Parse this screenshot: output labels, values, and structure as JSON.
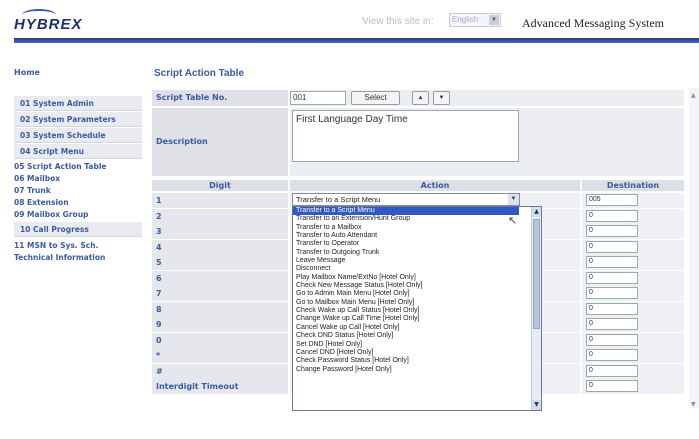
{
  "header": {
    "logo": "HYBREX",
    "view_label": "View this site in:",
    "language": "English",
    "app_title": "Advanced Messaging System"
  },
  "sidebar": {
    "home": "Home",
    "items": [
      {
        "label": "01 System Admin",
        "boxed": true
      },
      {
        "label": "02 System Parameters",
        "boxed": true
      },
      {
        "label": "03 System Schedule",
        "boxed": true
      },
      {
        "label": "04 Script Menu",
        "boxed": true
      },
      {
        "label": "05 Script Action Table",
        "boxed": false
      },
      {
        "label": "06 Mailbox",
        "boxed": false
      },
      {
        "label": "07 Trunk",
        "boxed": false
      },
      {
        "label": "08 Extension",
        "boxed": false
      },
      {
        "label": "09 Mailbox Group",
        "boxed": false
      },
      {
        "label": "10 Call Progress",
        "boxed": true
      },
      {
        "label": "11 MSN to Sys. Sch.",
        "boxed": false
      },
      {
        "label": "Technical Information",
        "boxed": false
      }
    ]
  },
  "main": {
    "title": "Script Action Table",
    "script_table_label": "Script Table No.",
    "script_table_value": "001",
    "select_button": "Select",
    "up_button": "▲",
    "down_button": "▼",
    "description_label": "Description",
    "description_value": "First Language Day Time",
    "columns": {
      "digit": "Digit",
      "action": "Action",
      "destination": "Destination"
    },
    "rows": [
      {
        "digit": "1",
        "dest": "005"
      },
      {
        "digit": "2",
        "dest": "0"
      },
      {
        "digit": "3",
        "dest": "0"
      },
      {
        "digit": "4",
        "dest": "0"
      },
      {
        "digit": "5",
        "dest": "0"
      },
      {
        "digit": "6",
        "dest": "0"
      },
      {
        "digit": "7",
        "dest": "0"
      },
      {
        "digit": "8",
        "dest": "0"
      },
      {
        "digit": "9",
        "dest": "0"
      },
      {
        "digit": "0",
        "dest": "0"
      },
      {
        "digit": "*",
        "dest": "0"
      },
      {
        "digit": "#",
        "dest": "0"
      },
      {
        "digit": "Interdigit Timeout",
        "dest": "0"
      }
    ],
    "action_selected": "Transfer to a Script Menu",
    "action_options": [
      "Transfer to a Script Menu",
      "Transfer to an Extension/Hunt Group",
      "Transfer to a Mailbox",
      "Transfer to Auto Attendant",
      "Transfer to Operator",
      "Transfer to Outgoing Trunk",
      "Leave Message",
      "Disconnect",
      "Play Mailbox Name/ExtNo [Hotel Only]",
      "Check New Message Status [Hotel Only]",
      "Go to Admin Main Menu [Hotel Only]",
      "Go to Mailbox Main Menu [Hotel Only]",
      "Check Wake up Call Status [Hotel Only]",
      "Change Wake up Call Time [Hotel Only]",
      "Cancel Wake up Call [Hotel Only]",
      "Check DND Status [Hotel Only]",
      "Set DND [Hotel Only]",
      "Cancel DND [Hotel Only]",
      "Check Password Status [Hotel Only]",
      "Change Password [Hotel Only]"
    ]
  },
  "colors": {
    "brand": "#1a2e6e",
    "nav_text": "#3b5aa0",
    "selection": "#3158c6"
  }
}
